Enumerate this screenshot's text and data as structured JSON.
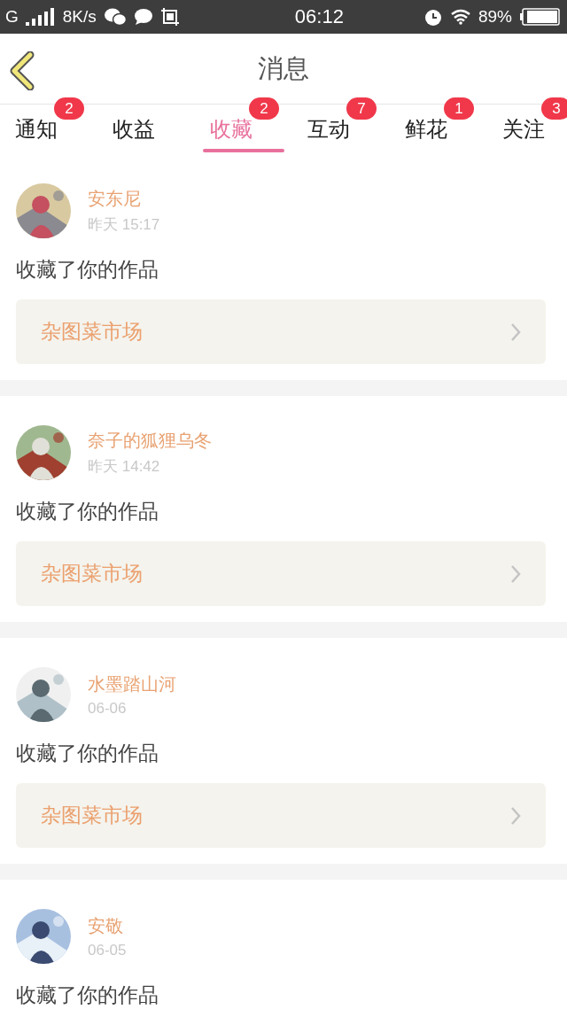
{
  "status_bar": {
    "network": "G",
    "speed": "8K/s",
    "time": "06:12",
    "battery": "89%"
  },
  "header": {
    "title": "消息"
  },
  "tabs": [
    {
      "label": "通知",
      "badge": "2",
      "selected": false
    },
    {
      "label": "收益",
      "selected": false
    },
    {
      "label": "收藏",
      "badge": "2",
      "selected": true
    },
    {
      "label": "互动",
      "badge": "7",
      "selected": false
    },
    {
      "label": "鲜花",
      "badge": "1",
      "selected": false
    },
    {
      "label": "关注",
      "badge": "3",
      "selected": false
    }
  ],
  "messages": [
    {
      "name": "安东尼",
      "time": "昨天 15:17",
      "action": "收藏了你的作品",
      "link": "杂图菜市场"
    },
    {
      "name": "奈子的狐狸乌冬",
      "time": "昨天 14:42",
      "action": "收藏了你的作品",
      "link": "杂图菜市场"
    },
    {
      "name": "水墨踏山河",
      "time": "06-06",
      "action": "收藏了你的作品",
      "link": "杂图菜市场"
    },
    {
      "name": "安敬",
      "time": "06-05",
      "action": "收藏了你的作品"
    }
  ]
}
